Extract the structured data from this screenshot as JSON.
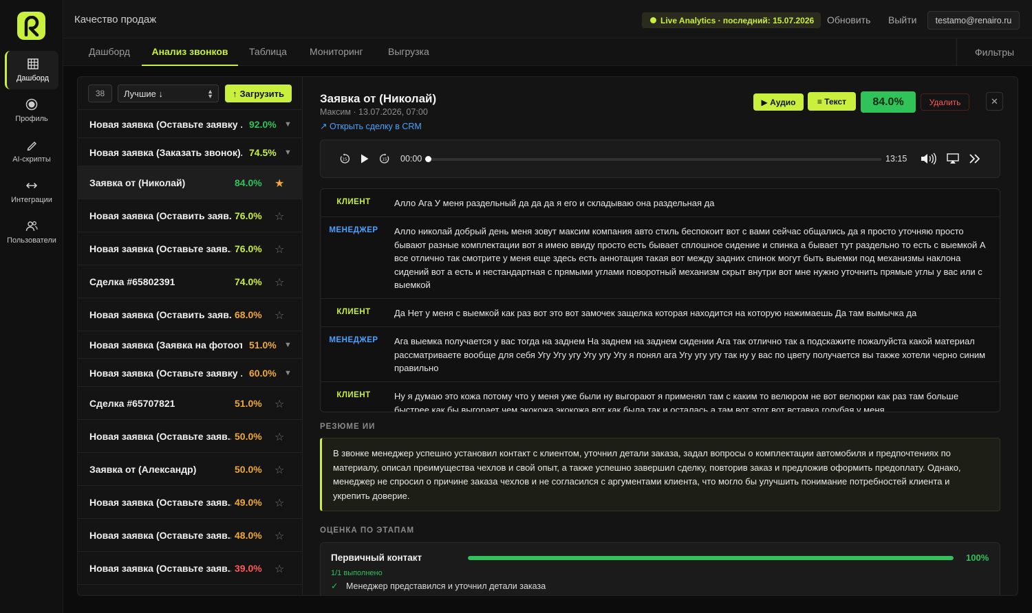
{
  "app": {
    "title": "Качество продаж"
  },
  "topbar": {
    "live": "Live Analytics · последний: 15.07.2026",
    "refresh": "Обновить",
    "logout": "Выйти",
    "email": "testamo@renairo.ru"
  },
  "sidebar": {
    "items": [
      {
        "label": "Дашборд",
        "icon": "dashboard-icon"
      },
      {
        "label": "Профиль",
        "icon": "profile-icon"
      },
      {
        "label": "AI-скрипты",
        "icon": "pen-icon"
      },
      {
        "label": "Интеграции",
        "icon": "arrows-icon"
      },
      {
        "label": "Пользователи",
        "icon": "users-icon"
      }
    ]
  },
  "tabs": [
    {
      "label": "Дашборд"
    },
    {
      "label": "Анализ звонков"
    },
    {
      "label": "Таблица"
    },
    {
      "label": "Мониторинг"
    },
    {
      "label": "Выгрузка"
    }
  ],
  "filters_label": "Фильтры",
  "list": {
    "count": "38",
    "sort": "Лучшие ↓",
    "upload": "Загрузить",
    "rows": [
      {
        "name": "Новая заявка (Оставьте заявку ...",
        "score": "92.0%",
        "color": "#2fc35a",
        "marker": "▼"
      },
      {
        "name": "Новая заявка (Заказать звонок)...",
        "score": "74.5%",
        "color": "#c8f03c",
        "marker": "▼"
      },
      {
        "name": "Заявка от (Николай)",
        "score": "84.0%",
        "color": "#2fc35a",
        "marker": "★"
      },
      {
        "name": "Новая заявка (Оставить заяв...",
        "score": "76.0%",
        "color": "#c8f03c",
        "marker": "☆"
      },
      {
        "name": "Новая заявка (Оставьте заяв...",
        "score": "76.0%",
        "color": "#c8f03c",
        "marker": "☆"
      },
      {
        "name": "Сделка #65802391",
        "score": "74.0%",
        "color": "#c8f03c",
        "marker": "☆"
      },
      {
        "name": "Новая заявка (Оставить заяв...",
        "score": "68.0%",
        "color": "#f0a93a",
        "marker": "☆"
      },
      {
        "name": "Новая заявка (Заявка на фотоот...",
        "score": "51.0%",
        "color": "#f0a93a",
        "marker": "▼"
      },
      {
        "name": "Новая заявка (Оставьте заявку ...",
        "score": "60.0%",
        "color": "#f0a93a",
        "marker": "▼"
      },
      {
        "name": "Сделка #65707821",
        "score": "51.0%",
        "color": "#f0a93a",
        "marker": "☆"
      },
      {
        "name": "Новая заявка (Оставьте заяв...",
        "score": "50.0%",
        "color": "#f0a93a",
        "marker": "☆"
      },
      {
        "name": "Заявка от (Александр)",
        "score": "50.0%",
        "color": "#f0a93a",
        "marker": "☆"
      },
      {
        "name": "Новая заявка (Оставьте заяв...",
        "score": "49.0%",
        "color": "#f0a93a",
        "marker": "☆"
      },
      {
        "name": "Новая заявка (Оставьте заяв...",
        "score": "48.0%",
        "color": "#f0a93a",
        "marker": "☆"
      },
      {
        "name": "Новая заявка (Оставьте заяв...",
        "score": "39.0%",
        "color": "#ff5a5a",
        "marker": "☆"
      }
    ]
  },
  "detail": {
    "title": "Заявка от (Николай)",
    "meta": "Максим · 13.07.2026, 07:00",
    "crm_link": "↗ Открыть сделку в CRM",
    "audio_btn": "▶ Аудио",
    "text_btn": "≡ Текст",
    "score": "84.0%",
    "delete_btn": "Удалить",
    "close": "✕",
    "player": {
      "current": "00:00",
      "total": "13:15",
      "progress": 0
    },
    "transcript": [
      {
        "role": "КЛИЕНТ",
        "type": "client",
        "text": "Алло Ага У меня раздельный да да да я его и складываю она раздельная да"
      },
      {
        "role": "МЕНЕДЖЕР",
        "type": "manager",
        "text": "Алло николай добрый день меня зовут максим компания авто стиль беспокоит вот с вами сейчас общались да я просто уточняю просто бывают разные комплектации вот я имею ввиду просто есть бывает сплошное сидение и спинка а бывает тут раздельно то есть с выемкой А все отлично так смотрите у меня еще здесь есть аннотация такая вот между задних спинок могут быть выемки под механизмы наклона сидений вот а есть и нестандартная с прямыми углами поворотный механизм скрыт внутри вот мне нужно уточнить прямые углы у вас или с выемкой"
      },
      {
        "role": "КЛИЕНТ",
        "type": "client",
        "text": "Да Нет у меня с выемкой как раз вот это вот замочек защелка которая находится на которую нажимаешь Да там вымычка да"
      },
      {
        "role": "МЕНЕДЖЕР",
        "type": "manager",
        "text": "Ага выемка получается у вас тогда на заднем На заднем на заднем сидении Ага так отлично так а подскажите пожалуйста какой материал рассматриваете вообще для себя Угу Угу угу Угу угу Угу я понял ага Угу угу угу так ну у вас по цвету получается вы также хотели черно синим правильно"
      },
      {
        "role": "КЛИЕНТ",
        "type": "client",
        "text": "Ну я думаю это кожа потому что у меня уже были ну выгорают я применял там с каким то велюром не вот велюрки как раз там больше быстрее как бы выгорает чем экокожа экокожа вот как была так и осталась а там вот этот вот вставка голубая у меня"
      }
    ],
    "summary_label": "РЕЗЮМЕ ИИ",
    "summary": "В звонке менеджер успешно установил контакт с клиентом, уточнил детали заказа, задал вопросы о комплектации автомобиля и предпочтениях по материалу, описал преимущества чехлов и свой опыт, а также успешно завершил сделку, повторив заказ и предложив оформить предоплату. Однако, менеджер не спросил о причине заказа чехлов и не согласился с аргументами клиента, что могло бы улучшить понимание потребностей клиента и укрепить доверие.",
    "stages_label": "ОЦЕНКА ПО ЭТАПАМ",
    "stage": {
      "name": "Первичный контакт",
      "percent": "100%",
      "fill": 1.0,
      "done": "1/1 выполнено",
      "item": "Менеджер представился и уточнил детали заказа"
    }
  },
  "colors": {
    "accent": "#c8f03c",
    "success": "#2fc35a",
    "warning": "#f0a93a",
    "danger": "#ff5a5a",
    "link": "#4aa3ff"
  }
}
